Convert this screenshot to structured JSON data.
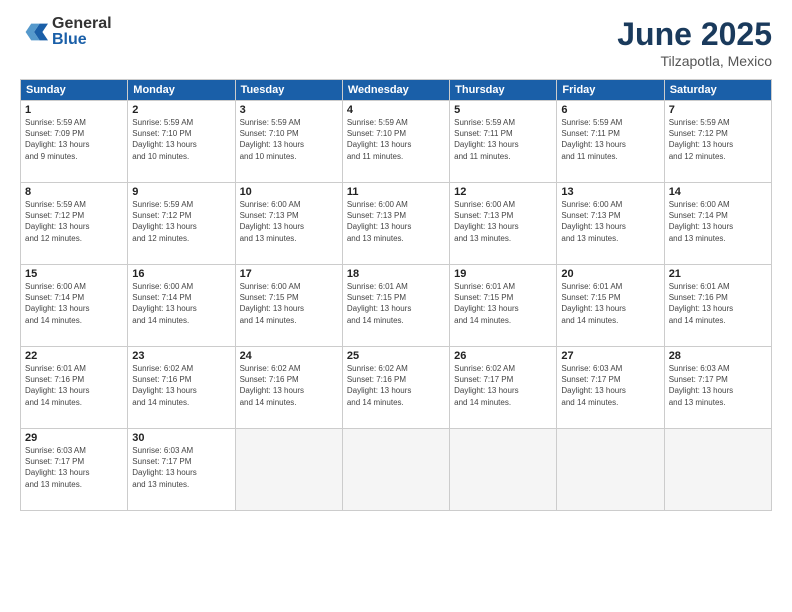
{
  "logo": {
    "general": "General",
    "blue": "Blue"
  },
  "title": "June 2025",
  "subtitle": "Tilzapotla, Mexico",
  "headers": [
    "Sunday",
    "Monday",
    "Tuesday",
    "Wednesday",
    "Thursday",
    "Friday",
    "Saturday"
  ],
  "days": [
    {
      "num": "",
      "info": ""
    },
    {
      "num": "",
      "info": ""
    },
    {
      "num": "",
      "info": ""
    },
    {
      "num": "",
      "info": ""
    },
    {
      "num": "",
      "info": ""
    },
    {
      "num": "",
      "info": ""
    },
    {
      "num": "7",
      "info": "Sunrise: 5:59 AM\nSunset: 7:12 PM\nDaylight: 13 hours\nand 12 minutes."
    },
    {
      "num": "1",
      "info": "Sunrise: 5:59 AM\nSunset: 7:09 PM\nDaylight: 13 hours\nand 9 minutes."
    },
    {
      "num": "2",
      "info": "Sunrise: 5:59 AM\nSunset: 7:10 PM\nDaylight: 13 hours\nand 10 minutes."
    },
    {
      "num": "3",
      "info": "Sunrise: 5:59 AM\nSunset: 7:10 PM\nDaylight: 13 hours\nand 10 minutes."
    },
    {
      "num": "4",
      "info": "Sunrise: 5:59 AM\nSunset: 7:10 PM\nDaylight: 13 hours\nand 11 minutes."
    },
    {
      "num": "5",
      "info": "Sunrise: 5:59 AM\nSunset: 7:11 PM\nDaylight: 13 hours\nand 11 minutes."
    },
    {
      "num": "6",
      "info": "Sunrise: 5:59 AM\nSunset: 7:11 PM\nDaylight: 13 hours\nand 11 minutes."
    },
    {
      "num": "7",
      "info": "Sunrise: 5:59 AM\nSunset: 7:12 PM\nDaylight: 13 hours\nand 12 minutes."
    },
    {
      "num": "8",
      "info": "Sunrise: 5:59 AM\nSunset: 7:12 PM\nDaylight: 13 hours\nand 12 minutes."
    },
    {
      "num": "9",
      "info": "Sunrise: 5:59 AM\nSunset: 7:12 PM\nDaylight: 13 hours\nand 12 minutes."
    },
    {
      "num": "10",
      "info": "Sunrise: 6:00 AM\nSunset: 7:13 PM\nDaylight: 13 hours\nand 13 minutes."
    },
    {
      "num": "11",
      "info": "Sunrise: 6:00 AM\nSunset: 7:13 PM\nDaylight: 13 hours\nand 13 minutes."
    },
    {
      "num": "12",
      "info": "Sunrise: 6:00 AM\nSunset: 7:13 PM\nDaylight: 13 hours\nand 13 minutes."
    },
    {
      "num": "13",
      "info": "Sunrise: 6:00 AM\nSunset: 7:13 PM\nDaylight: 13 hours\nand 13 minutes."
    },
    {
      "num": "14",
      "info": "Sunrise: 6:00 AM\nSunset: 7:14 PM\nDaylight: 13 hours\nand 13 minutes."
    },
    {
      "num": "15",
      "info": "Sunrise: 6:00 AM\nSunset: 7:14 PM\nDaylight: 13 hours\nand 14 minutes."
    },
    {
      "num": "16",
      "info": "Sunrise: 6:00 AM\nSunset: 7:14 PM\nDaylight: 13 hours\nand 14 minutes."
    },
    {
      "num": "17",
      "info": "Sunrise: 6:00 AM\nSunset: 7:15 PM\nDaylight: 13 hours\nand 14 minutes."
    },
    {
      "num": "18",
      "info": "Sunrise: 6:01 AM\nSunset: 7:15 PM\nDaylight: 13 hours\nand 14 minutes."
    },
    {
      "num": "19",
      "info": "Sunrise: 6:01 AM\nSunset: 7:15 PM\nDaylight: 13 hours\nand 14 minutes."
    },
    {
      "num": "20",
      "info": "Sunrise: 6:01 AM\nSunset: 7:15 PM\nDaylight: 13 hours\nand 14 minutes."
    },
    {
      "num": "21",
      "info": "Sunrise: 6:01 AM\nSunset: 7:16 PM\nDaylight: 13 hours\nand 14 minutes."
    },
    {
      "num": "22",
      "info": "Sunrise: 6:01 AM\nSunset: 7:16 PM\nDaylight: 13 hours\nand 14 minutes."
    },
    {
      "num": "23",
      "info": "Sunrise: 6:02 AM\nSunset: 7:16 PM\nDaylight: 13 hours\nand 14 minutes."
    },
    {
      "num": "24",
      "info": "Sunrise: 6:02 AM\nSunset: 7:16 PM\nDaylight: 13 hours\nand 14 minutes."
    },
    {
      "num": "25",
      "info": "Sunrise: 6:02 AM\nSunset: 7:16 PM\nDaylight: 13 hours\nand 14 minutes."
    },
    {
      "num": "26",
      "info": "Sunrise: 6:02 AM\nSunset: 7:17 PM\nDaylight: 13 hours\nand 14 minutes."
    },
    {
      "num": "27",
      "info": "Sunrise: 6:03 AM\nSunset: 7:17 PM\nDaylight: 13 hours\nand 14 minutes."
    },
    {
      "num": "28",
      "info": "Sunrise: 6:03 AM\nSunset: 7:17 PM\nDaylight: 13 hours\nand 13 minutes."
    },
    {
      "num": "29",
      "info": "Sunrise: 6:03 AM\nSunset: 7:17 PM\nDaylight: 13 hours\nand 13 minutes."
    },
    {
      "num": "30",
      "info": "Sunrise: 6:03 AM\nSunset: 7:17 PM\nDaylight: 13 hours\nand 13 minutes."
    },
    {
      "num": "",
      "info": ""
    },
    {
      "num": "",
      "info": ""
    },
    {
      "num": "",
      "info": ""
    },
    {
      "num": "",
      "info": ""
    },
    {
      "num": "",
      "info": ""
    }
  ]
}
